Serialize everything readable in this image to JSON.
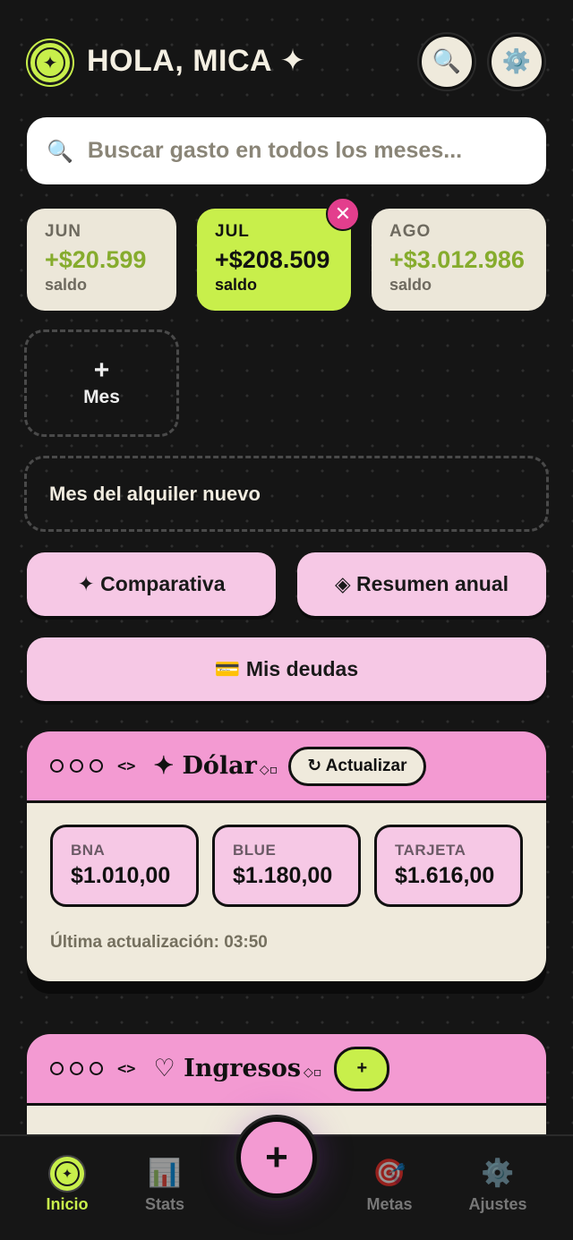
{
  "header": {
    "greeting": "HOLA, MICA ✦",
    "search_icon": "search-icon",
    "settings_icon": "gear-icon"
  },
  "search": {
    "placeholder": "Buscar gasto en todos los meses..."
  },
  "months": [
    {
      "month": "JUN",
      "value": "+$20.599",
      "label": "saldo",
      "active": false
    },
    {
      "month": "JUL",
      "value": "+$208.509",
      "label": "saldo",
      "active": true
    },
    {
      "month": "AGO",
      "value": "+$3.012.986",
      "label": "saldo",
      "active": false
    }
  ],
  "month_close_label": "✕",
  "add_month": {
    "plus": "+",
    "label": "Mes"
  },
  "note": "Mes del alquiler nuevo",
  "actions": {
    "compare": "✦ Comparativa",
    "annual": "◈ Resumen anual",
    "debts": "💳 Mis deudas"
  },
  "dollar_card": {
    "code": "<>",
    "title": "✦ Dólar",
    "title_tail": "◇▫",
    "refresh": "↻ Actualizar",
    "rates": [
      {
        "name": "BNA",
        "value": "$1.010,00"
      },
      {
        "name": "BLUE",
        "value": "$1.180,00"
      },
      {
        "name": "TARJETA",
        "value": "$1.616,00"
      }
    ],
    "updated": "Última actualización: 03:50"
  },
  "income_card": {
    "code": "<>",
    "title": "♡ Ingresos",
    "title_tail": "◇▫",
    "add": "+"
  },
  "nav": {
    "home": "Inicio",
    "stats": "Stats",
    "fab": "+",
    "goals": "Metas",
    "settings": "Ajustes"
  },
  "colors": {
    "accent_green": "#c8ef4b",
    "accent_pink": "#f39ad2",
    "light_pink": "#f6c8e5",
    "cream": "#efeadc",
    "background": "#151515",
    "positive_value": "#86ac2d",
    "close_badge": "#e33e8d"
  }
}
